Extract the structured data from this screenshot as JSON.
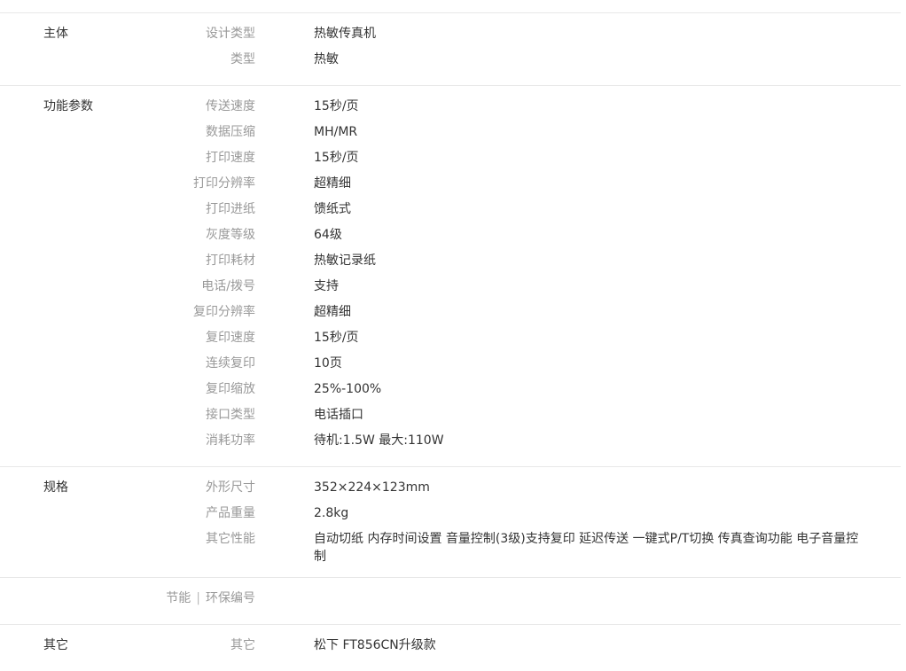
{
  "groups": [
    {
      "title": "主体",
      "rows": [
        {
          "label": "设计类型",
          "value": "热敏传真机"
        },
        {
          "label": "类型",
          "value": "热敏"
        }
      ]
    },
    {
      "title": "功能参数",
      "rows": [
        {
          "label": "传送速度",
          "value": "15秒/页"
        },
        {
          "label": "数据压缩",
          "value": "MH/MR"
        },
        {
          "label": "打印速度",
          "value": "15秒/页"
        },
        {
          "label": "打印分辨率",
          "value": "超精细"
        },
        {
          "label": "打印进纸",
          "value": "馈纸式"
        },
        {
          "label": "灰度等级",
          "value": "64级"
        },
        {
          "label": "打印耗材",
          "value": "热敏记录纸"
        },
        {
          "label": "电话/拨号",
          "value": "支持"
        },
        {
          "label": "复印分辨率",
          "value": "超精细"
        },
        {
          "label": "复印速度",
          "value": "15秒/页"
        },
        {
          "label": "连续复印",
          "value": "10页"
        },
        {
          "label": "复印缩放",
          "value": "25%-100%"
        },
        {
          "label": "接口类型",
          "value": "电话插口"
        },
        {
          "label": "消耗功率",
          "value": "待机:1.5W 最大:110W"
        }
      ]
    },
    {
      "title": "规格",
      "rows": [
        {
          "label": "外形尺寸",
          "value": "352×224×123mm"
        },
        {
          "label": "产品重量",
          "value": "2.8kg"
        },
        {
          "label": "其它性能",
          "value": "自动切纸 内存时间设置 音量控制(3级)支持复印 延迟传送 一键式P/T切换 传真查询功能 电子音量控制"
        }
      ]
    },
    {
      "title": "",
      "rows": [
        {
          "label_a": "节能",
          "separator": "|",
          "label_b": "环保编号",
          "value": ""
        }
      ]
    },
    {
      "title": "其它",
      "rows": [
        {
          "label": "其它",
          "value": "松下 FT856CN升级款"
        }
      ]
    }
  ]
}
